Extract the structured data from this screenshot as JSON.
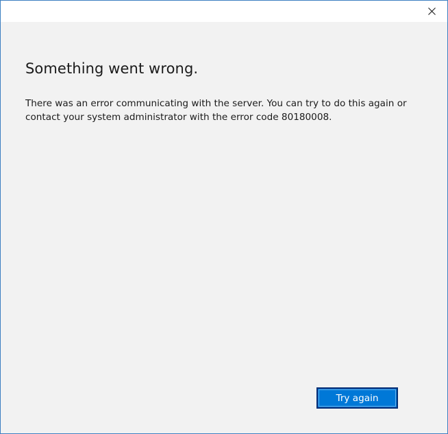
{
  "window": {
    "close_icon": "close-icon"
  },
  "dialog": {
    "title": "Something went wrong.",
    "message": "There was an error communicating with the server. You can try to do this again or contact your system administrator with the error code 80180008.",
    "try_again_label": "Try again"
  },
  "colors": {
    "accent": "#0078d7",
    "button_border": "#002d73",
    "background": "#f2f2f2",
    "titlebar": "#ffffff"
  }
}
